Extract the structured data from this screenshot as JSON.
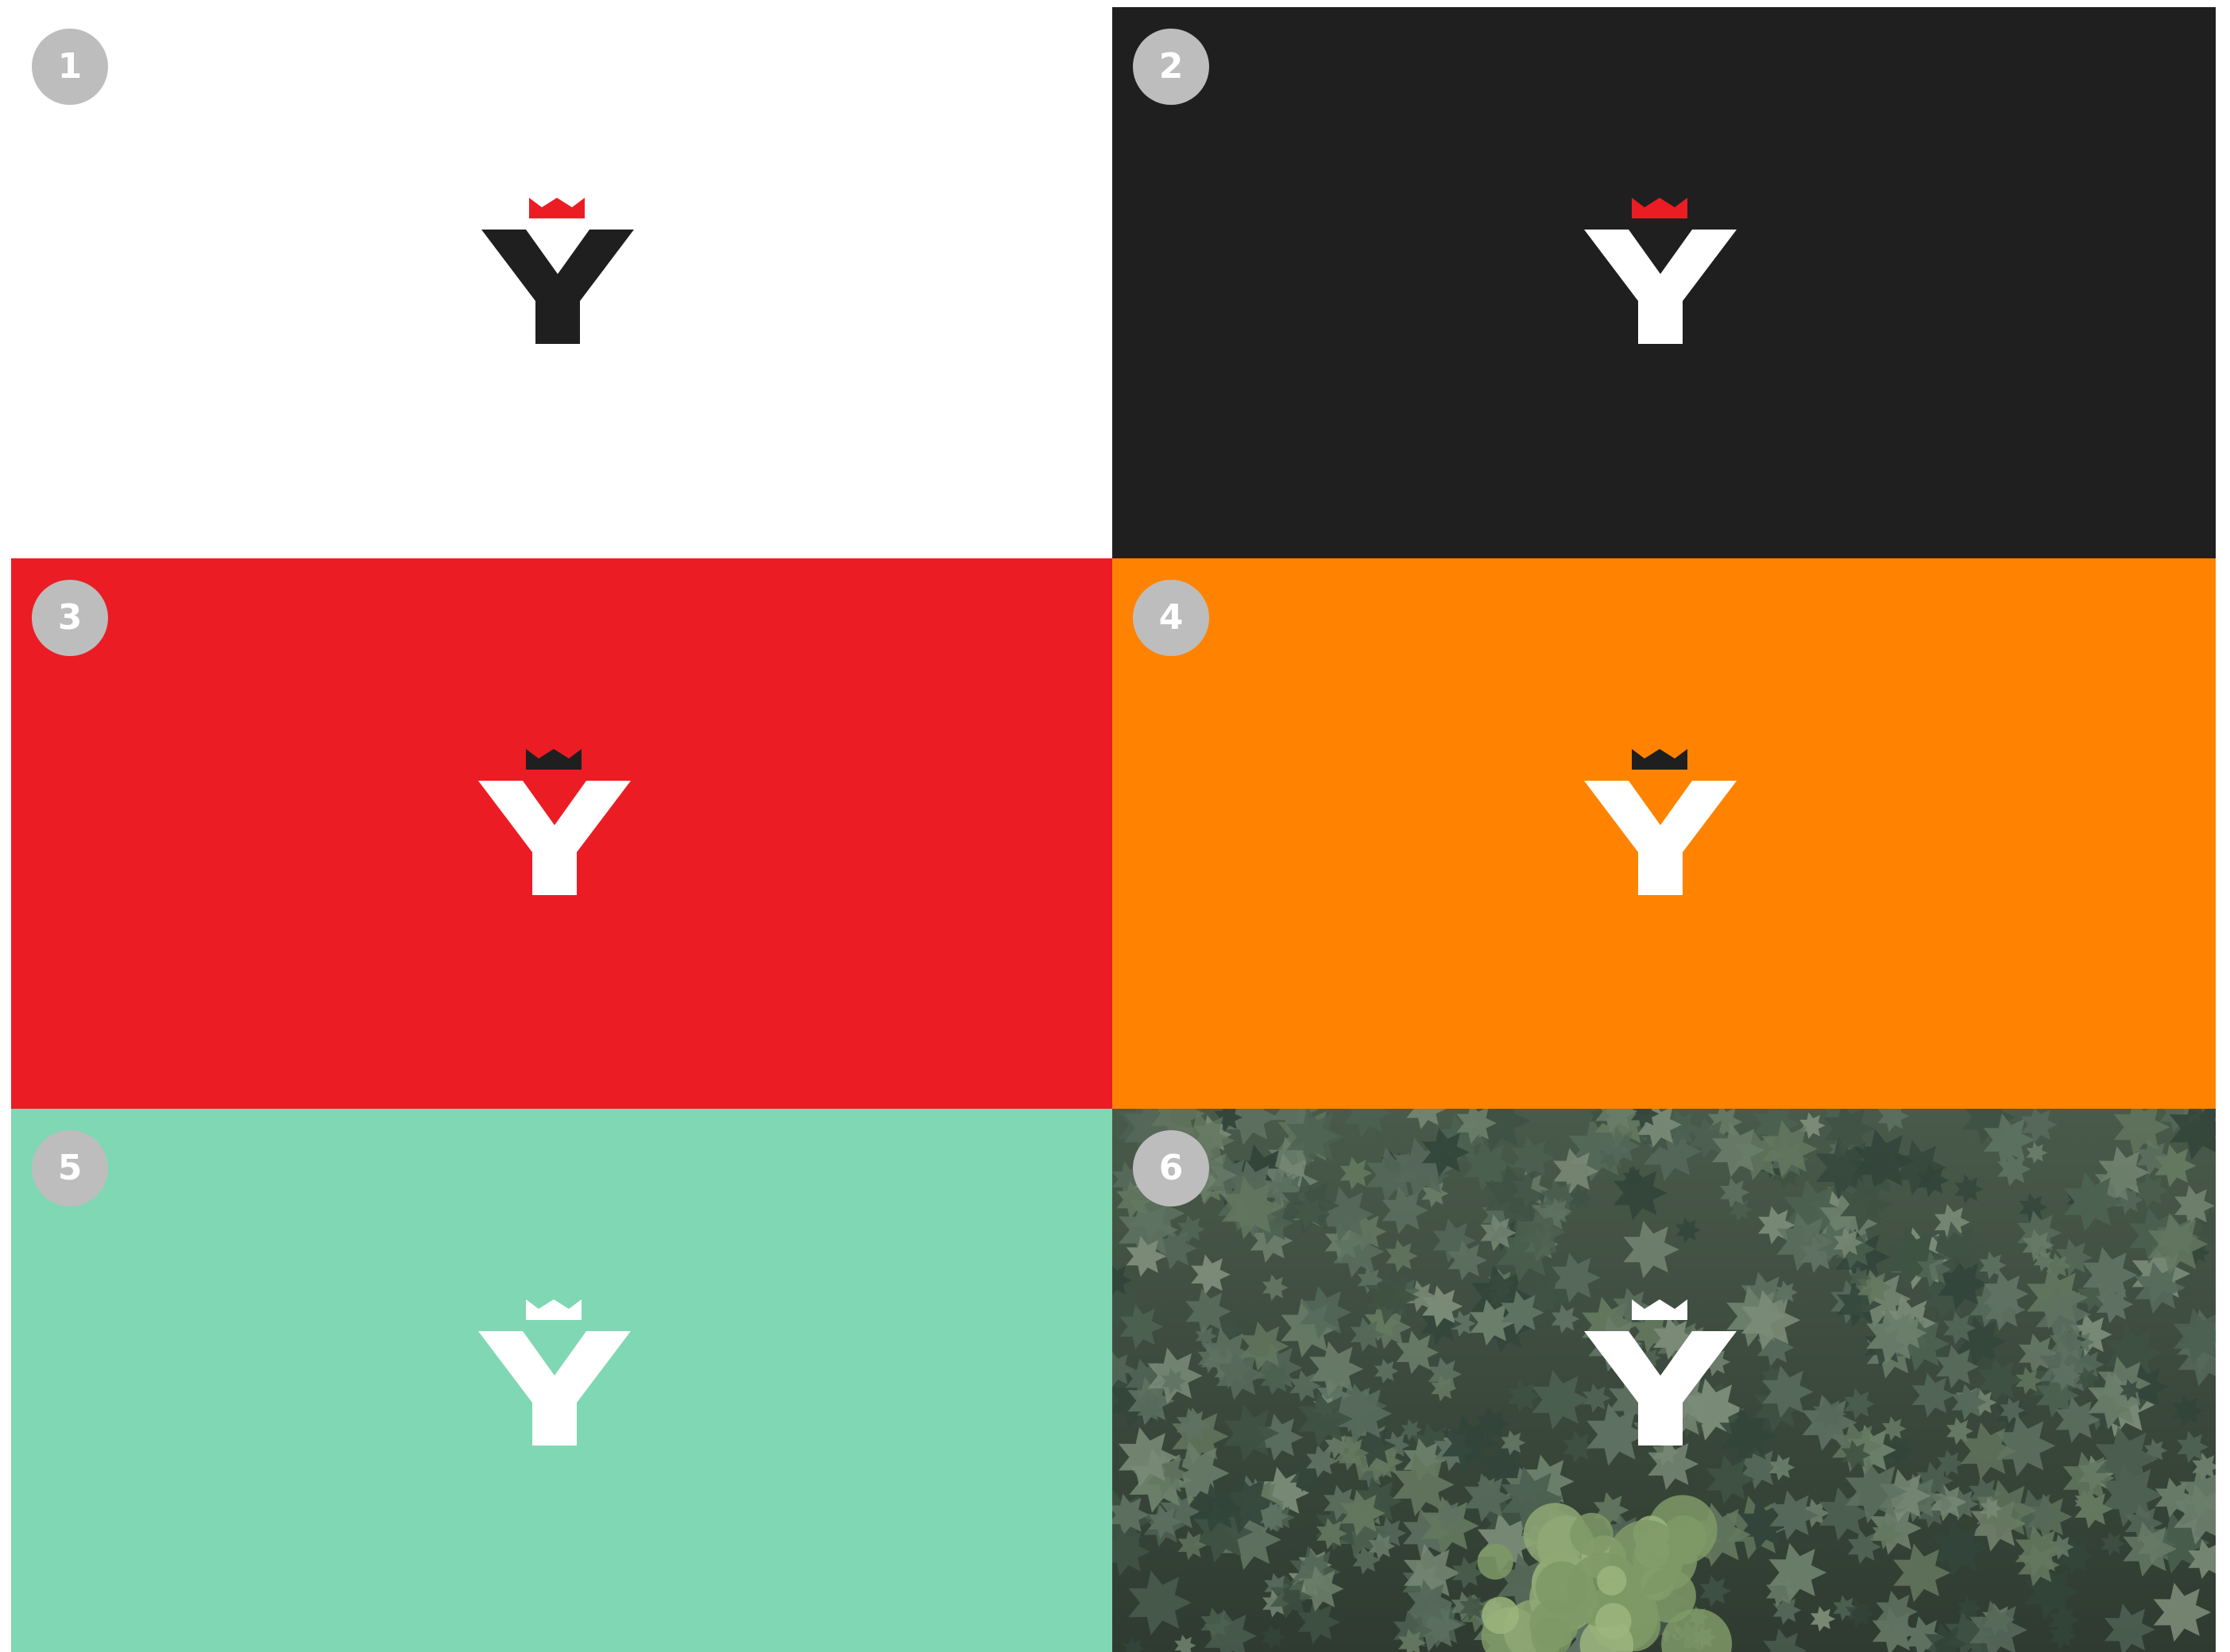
{
  "panels": [
    {
      "number": "1",
      "background": "#ffffff",
      "y_color": "#1f1f1f",
      "crown_color": "#ec1c24"
    },
    {
      "number": "2",
      "background": "#1f1f1f",
      "y_color": "#ffffff",
      "crown_color": "#ec1c24"
    },
    {
      "number": "3",
      "background": "#ec1c24",
      "y_color": "#ffffff",
      "crown_color": "#1f1f1f"
    },
    {
      "number": "4",
      "background": "#ff8300",
      "y_color": "#ffffff",
      "crown_color": "#1f1f1f"
    },
    {
      "number": "5",
      "background": "#80d7b3",
      "y_color": "#ffffff",
      "crown_color": "#ffffff"
    },
    {
      "number": "6",
      "background": "forest-photo",
      "y_color": "#ffffff",
      "crown_color": "#ffffff"
    }
  ],
  "badge_color": "#bdbdbd",
  "logo_icon": "crowned-y-logo-icon"
}
